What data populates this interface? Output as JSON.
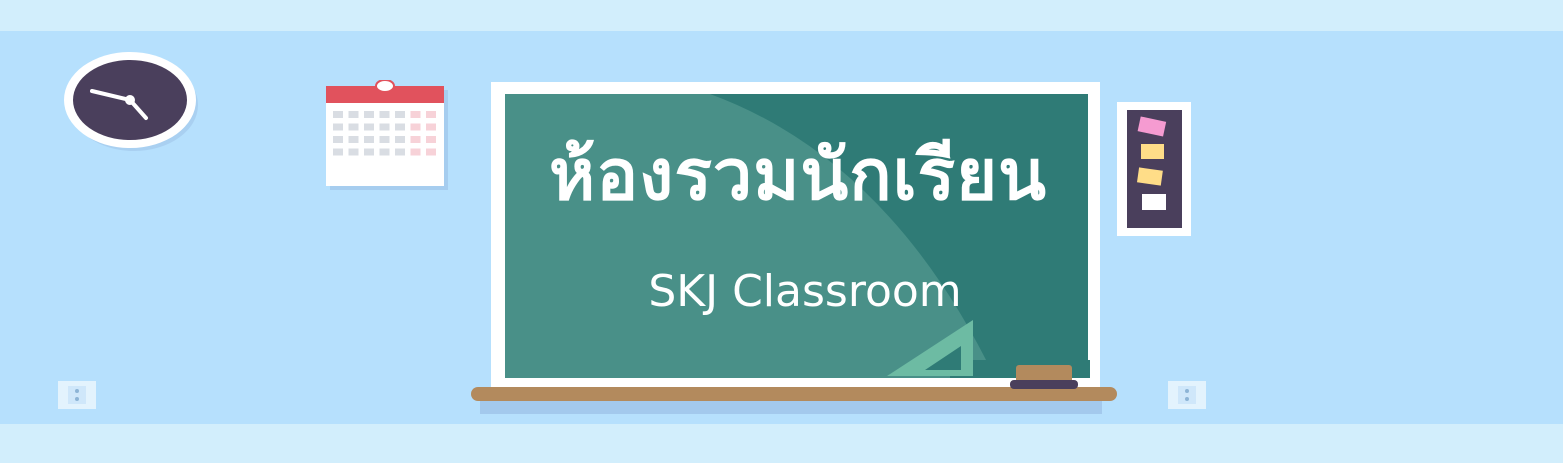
{
  "board": {
    "title": "ห้องรวมนักเรียน",
    "subtitle": "SKJ Classroom"
  },
  "colors": {
    "wall": "#b6e0fd",
    "band": "#d2eefc",
    "board_frame": "#ffffff",
    "board_surface": "#2f7b76",
    "chalk_ledge": "#b38a5d",
    "calendar_header": "#e1525d",
    "clock_face": "#4a3f5c"
  },
  "icons": [
    "clock-icon",
    "calendar-icon",
    "bulletin-board-icon",
    "set-square-icon",
    "eraser-icon",
    "wall-outlet-icon"
  ]
}
